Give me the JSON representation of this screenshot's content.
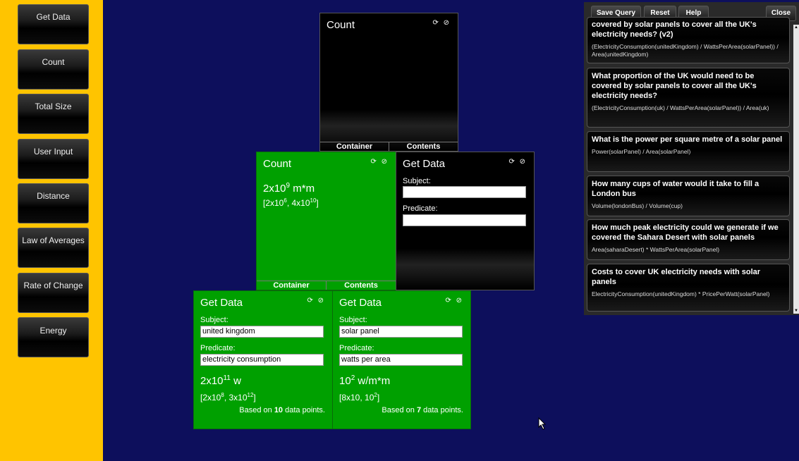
{
  "sidebar": {
    "items": [
      {
        "label": "Get Data"
      },
      {
        "label": "Count"
      },
      {
        "label": "Total Size"
      },
      {
        "label": "User Input"
      },
      {
        "label": "Distance"
      },
      {
        "label": "Law of Averages"
      },
      {
        "label": "Rate of Change"
      },
      {
        "label": "Energy"
      }
    ]
  },
  "icons": {
    "refresh": "refresh-icon",
    "remove": "remove-icon",
    "glyphs": "⟳ ⊘"
  },
  "tabs": {
    "container": "Container",
    "contents": "Contents"
  },
  "panels": {
    "count_top": {
      "title": "Count"
    },
    "count_green": {
      "title": "Count",
      "value_base": "2x10",
      "value_exp": "9",
      "value_unit": " m*m",
      "range_open": "[2x10",
      "range_exp1": "6",
      "range_mid": ", 4x10",
      "range_exp2": "10",
      "range_close": "]"
    },
    "getdata_black": {
      "title": "Get Data",
      "subject_label": "Subject:",
      "predicate_label": "Predicate:",
      "subject_value": "",
      "predicate_value": ""
    },
    "getdata_uk": {
      "title": "Get Data",
      "subject_label": "Subject:",
      "subject_value": "united kingdom",
      "predicate_label": "Predicate:",
      "predicate_value": "electricity consumption",
      "value_base": "2x10",
      "value_exp": "11",
      "value_unit": " w",
      "range_open": "[2x10",
      "range_exp1": "8",
      "range_mid": ", 3x10",
      "range_exp2": "12",
      "range_close": "]",
      "basis_pre": "Based on ",
      "basis_n": "10",
      "basis_post": " data points."
    },
    "getdata_solar": {
      "title": "Get Data",
      "subject_label": "Subject:",
      "subject_value": "solar panel",
      "predicate_label": "Predicate:",
      "predicate_value": "watts per area",
      "value_base": "10",
      "value_exp": "2",
      "value_unit": " w/m*m",
      "range_open": "[8x10, 10",
      "range_exp1": "2",
      "range_close": "]",
      "basis_pre": "Based on ",
      "basis_n": "7",
      "basis_post": " data points."
    }
  },
  "query_panel": {
    "toolbar": {
      "save": "Save Query",
      "reset": "Reset",
      "help": "Help",
      "close": "Close"
    },
    "items": [
      {
        "question": "covered by solar panels to cover all the UK's electricity needs? (v2)",
        "formula": "(ElectricityConsumption(unitedKingdom) / WattsPerArea(solarPanel)) / Area(unitedKingdom)"
      },
      {
        "question": "What proportion of the UK would need to be covered by solar panels to cover all the UK's electricity needs?",
        "formula": "(ElectricityConsumption(uk) / WattsPerArea(solarPanel)) / Area(uk)"
      },
      {
        "question": "What is the power per square metre of a solar panel",
        "formula": "Power(solarPanel) / Area(solarPanel)"
      },
      {
        "question": "How many cups of water would it take to fill a London bus",
        "formula": "Volume(londonBus) / Volume(cup)"
      },
      {
        "question": "How much peak electricity could we generate if we covered the Sahara Desert with solar panels",
        "formula": "Area(saharaDesert) * WattsPerArea(solarPanel)"
      },
      {
        "question": "Costs to cover UK electricity needs with solar panels",
        "formula": "ElectricityConsumption(unitedKingdom) * PricePerWatt(solarPanel)"
      }
    ]
  }
}
